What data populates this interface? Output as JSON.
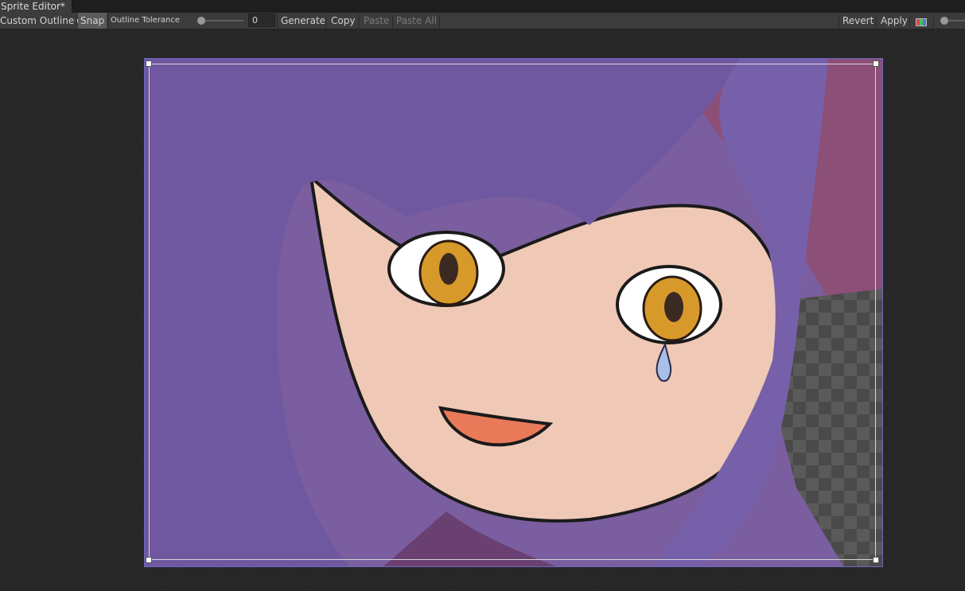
{
  "window": {
    "tab_title": "Sprite Editor*"
  },
  "toolbar": {
    "mode_dropdown": "Custom Outline",
    "snap_label": "Snap",
    "outline_tolerance_label": "Outline Tolerance",
    "outline_tolerance_value": "0",
    "outline_tolerance_slider_value": 0,
    "generate_label": "Generate",
    "copy_label": "Copy",
    "paste_label": "Paste",
    "paste_all_label": "Paste All",
    "revert_label": "Revert",
    "apply_label": "Apply",
    "color_toggle_icon": "rgb-channels-icon",
    "zoom_slider_value": 0
  },
  "colors": {
    "outline_selection": "#6d67c2",
    "canvas_bg": "#272727",
    "toolbar_bg": "#3c3c3c"
  }
}
